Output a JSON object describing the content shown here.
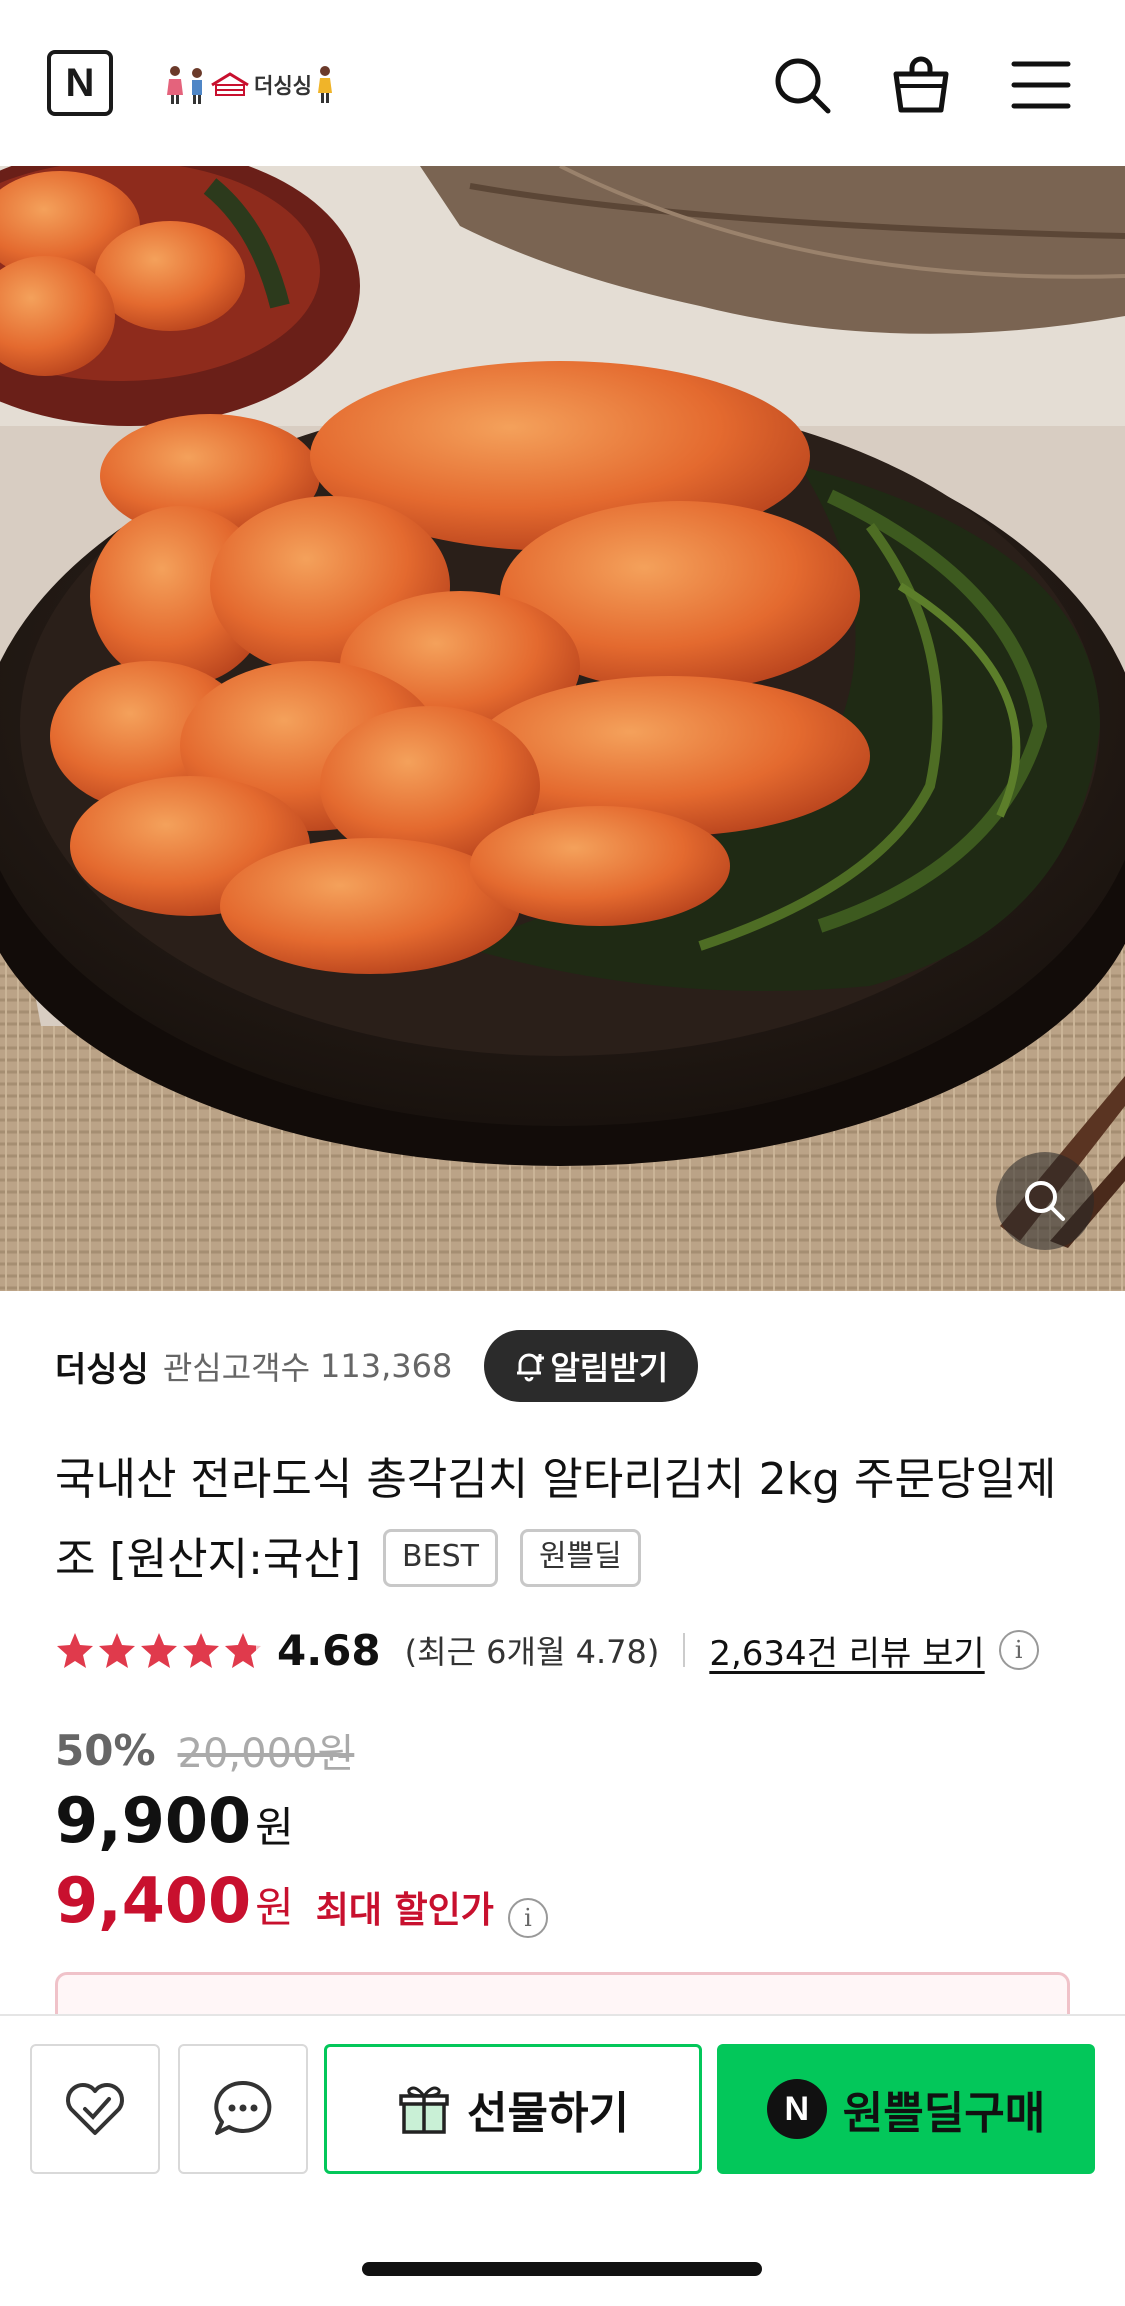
{
  "header": {
    "n_logo": "N",
    "store_logo_text": "더싱싱",
    "icons": [
      "search-icon",
      "cart-icon",
      "menu-icon"
    ]
  },
  "gallery": {
    "total_slides": 10,
    "active_index": 0,
    "video_index": 1
  },
  "seller": {
    "name": "더싱싱",
    "fans_label": "관심고객수",
    "fans_count": "113,368",
    "alert_button": "알림받기"
  },
  "product": {
    "title": "국내산 전라도식 총각김치 알타리김치 2kg 주문당일제조 [원산지:국산]",
    "badges": [
      "BEST",
      "원쁠딜"
    ]
  },
  "rating": {
    "stars": 4.68,
    "score": "4.68",
    "recent": "(최근 6개월 4.78)",
    "review_link": "2,634건 리뷰 보기",
    "info": "i"
  },
  "pricing": {
    "discount_rate": "50%",
    "original_price": "20,000원",
    "price": "9,900",
    "currency": "원",
    "max_discount_price": "9,400",
    "max_discount_label": "최대 할인가",
    "info": "i"
  },
  "actions": {
    "gift_label": "선물하기",
    "buy_label": "원쁠딜구매",
    "buy_n": "N"
  },
  "colors": {
    "accent_green": "#03c75a",
    "sale_red": "#c8102e",
    "dark": "#2b2b2b"
  }
}
